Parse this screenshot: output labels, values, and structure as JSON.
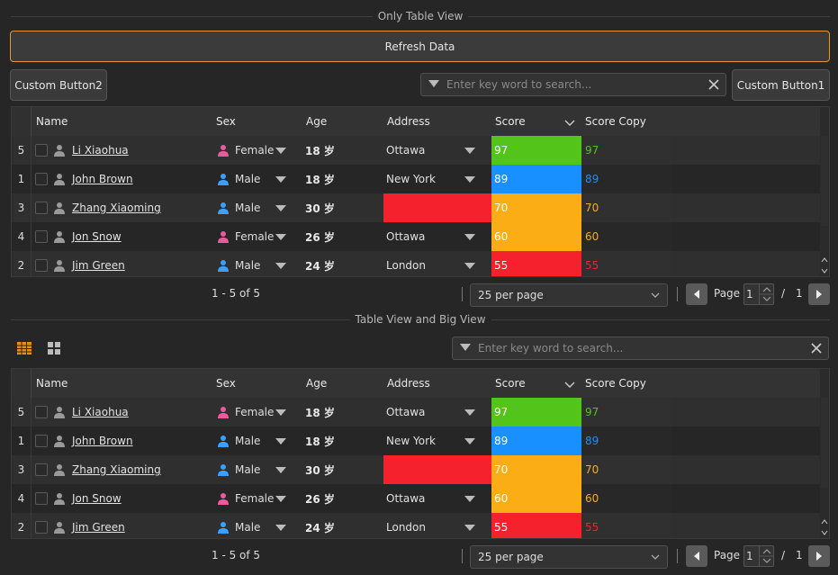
{
  "colors": {
    "accent": "#f08c00",
    "green": "#52c41a",
    "blue": "#1890ff",
    "orange": "#faad14",
    "red": "#f5222d",
    "female": "#eb5a9a",
    "male": "#3aa0ff"
  },
  "section1": {
    "title": "Only Table View",
    "refresh_label": "Refresh Data",
    "custom2_label": "Custom Button2",
    "custom1_label": "Custom Button1",
    "search_placeholder": "Enter key word to search...",
    "headers": [
      "Name",
      "Sex",
      "Age",
      "Address",
      "Score",
      "Score Copy"
    ],
    "footer": {
      "range": "1 - 5 of 5",
      "per_page": "25 per page",
      "page_label": "Page",
      "page_value": "1",
      "of_sep": "/",
      "total_pages": "1"
    }
  },
  "section2": {
    "title": "Table View and Big View",
    "search_placeholder": "Enter key word to search...",
    "headers": [
      "Name",
      "Sex",
      "Age",
      "Address",
      "Score",
      "Score Copy"
    ],
    "footer": {
      "range": "1 - 5 of 5",
      "per_page": "25 per page",
      "page_label": "Page",
      "page_value": "1",
      "of_sep": "/",
      "total_pages": "1"
    }
  },
  "rows": [
    {
      "num": "5",
      "name": "Li Xiaohua",
      "sex": "Female",
      "age": "18 岁",
      "address": "Ottawa",
      "score": "97",
      "score_copy": "97",
      "score_color": "#52c41a"
    },
    {
      "num": "1",
      "name": "John Brown",
      "sex": "Male",
      "age": "18 岁",
      "address": "New York",
      "score": "89",
      "score_copy": "89",
      "score_color": "#1890ff"
    },
    {
      "num": "3",
      "name": "Zhang Xiaoming",
      "sex": "Male",
      "age": "30 岁",
      "address": "",
      "score": "70",
      "score_copy": "70",
      "score_color": "#faad14"
    },
    {
      "num": "4",
      "name": "Jon Snow",
      "sex": "Female",
      "age": "26 岁",
      "address": "Ottawa",
      "score": "60",
      "score_copy": "60",
      "score_color": "#faad14"
    },
    {
      "num": "2",
      "name": "Jim Green",
      "sex": "Male",
      "age": "24 岁",
      "address": "London",
      "score": "55",
      "score_copy": "55",
      "score_color": "#f5222d"
    }
  ]
}
